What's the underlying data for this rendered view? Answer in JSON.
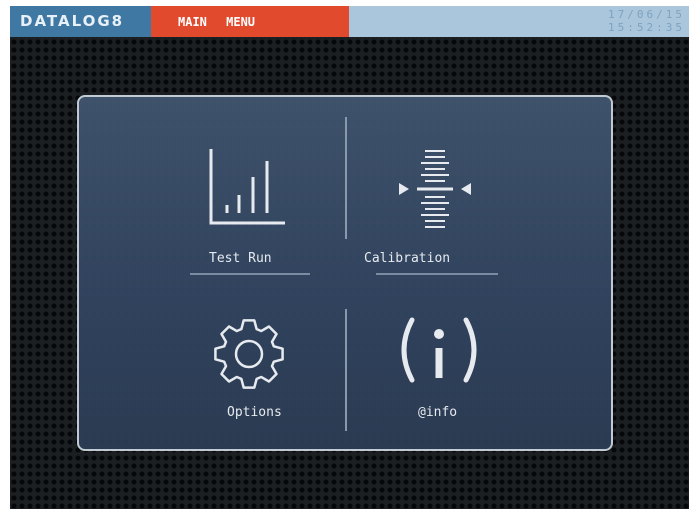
{
  "header": {
    "logo_text": "DATALOG8",
    "menu_title": "MAIN MENU",
    "date": "17/06/15",
    "time": "15:52:35"
  },
  "menu": {
    "items": [
      {
        "label": "Test Run",
        "icon": "bar-chart-icon"
      },
      {
        "label": "Calibration",
        "icon": "calibration-icon"
      },
      {
        "label": "Options",
        "icon": "gear-icon"
      },
      {
        "label": "@info",
        "icon": "info-icon"
      }
    ]
  },
  "colors": {
    "logo_bg": "#3f78a3",
    "menu_tab_bg": "#e24a2e",
    "status_bg": "#a9c6dc",
    "panel_bg": "#324560",
    "line": "#c8d0da"
  }
}
